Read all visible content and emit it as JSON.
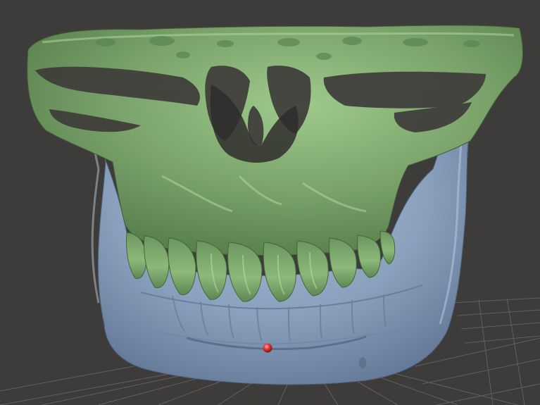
{
  "viewport": {
    "background": "#3e3c3a",
    "grid_color": "#6e6c6a"
  },
  "models": [
    {
      "name": "maxilla",
      "color": "#7aa26a"
    },
    {
      "name": "mandible",
      "color": "#8aa0bd"
    }
  ],
  "landmark": {
    "color": "#e23a3a"
  }
}
